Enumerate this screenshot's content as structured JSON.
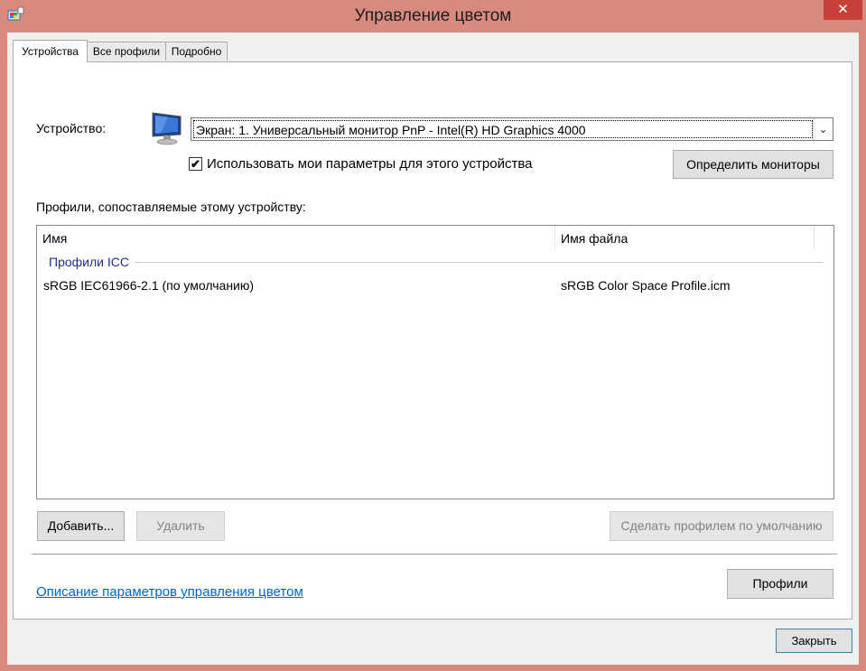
{
  "window": {
    "title": "Управление цветом",
    "close_symbol": "✕",
    "app_icon": "color-management-icon"
  },
  "tabs": [
    {
      "label": "Устройства",
      "active": true
    },
    {
      "label": "Все профили",
      "active": false
    },
    {
      "label": "Подробно",
      "active": false
    }
  ],
  "device": {
    "label": "Устройство:",
    "icon": "monitor-icon",
    "selected": "Экран: 1. Универсальный монитор PnP - Intel(R) HD Graphics 4000",
    "dropdown_symbol": "⌄",
    "use_my_settings_label": "Использовать мои параметры для этого устройства",
    "use_my_settings_checked": true,
    "check_symbol": "✔",
    "identify_button": "Определить мониторы"
  },
  "profiles": {
    "section_label": "Профили, сопоставляемые этому устройству:",
    "columns": [
      "Имя",
      "Имя файла"
    ],
    "group_label": "Профили ICC",
    "rows": [
      {
        "name": "sRGB IEC61966-2.1 (по умолчанию)",
        "file": "sRGB Color Space Profile.icm"
      }
    ]
  },
  "buttons": {
    "add": "Добавить...",
    "remove": "Удалить",
    "set_default": "Сделать профилем по умолчанию",
    "profiles": "Профили",
    "close": "Закрыть"
  },
  "link": {
    "text": "Описание параметров управления цветом"
  },
  "colors": {
    "frame": "#d98a7f",
    "close_button": "#c7403a",
    "link": "#0066cc",
    "group_header": "#1e3287"
  }
}
